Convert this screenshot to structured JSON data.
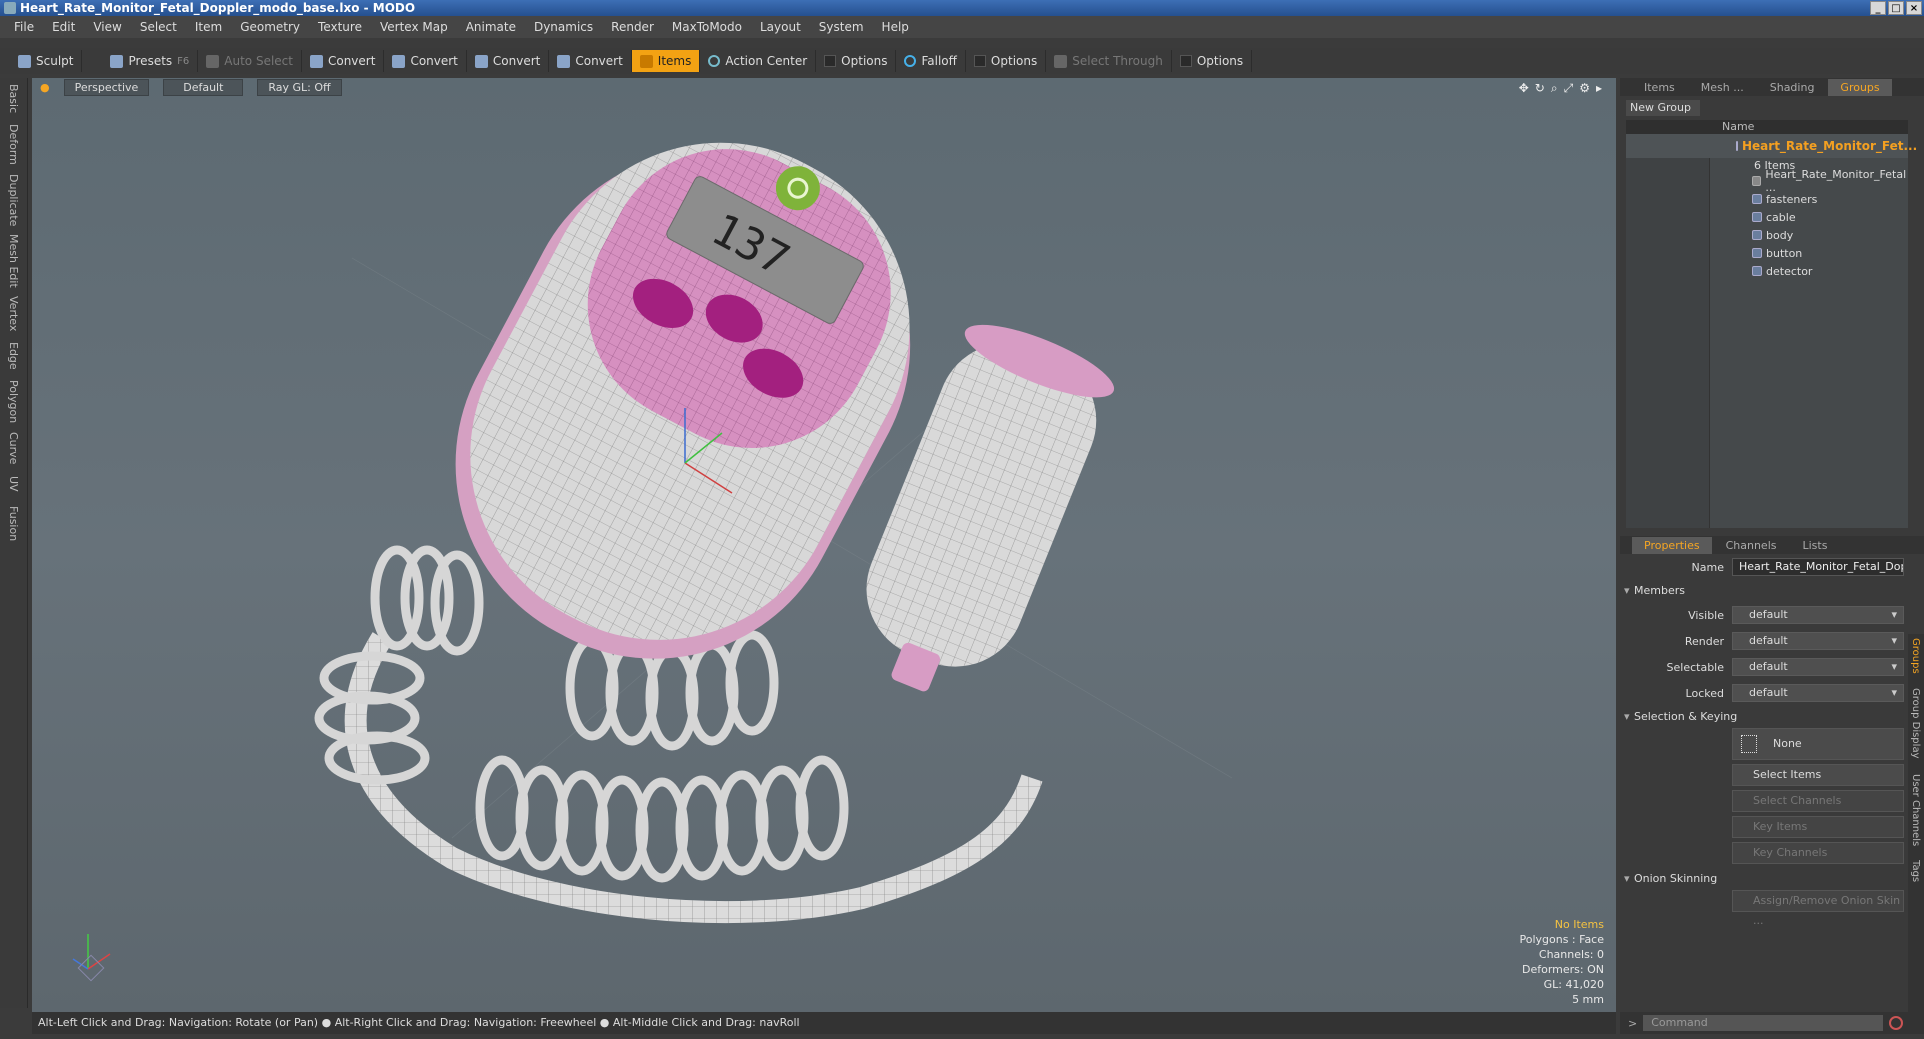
{
  "window": {
    "title": "Heart_Rate_Monitor_Fetal_Doppler_modo_base.lxo - MODO"
  },
  "menu": [
    "File",
    "Edit",
    "View",
    "Select",
    "Item",
    "Geometry",
    "Texture",
    "Vertex Map",
    "Animate",
    "Dynamics",
    "Render",
    "MaxToModo",
    "Layout",
    "System",
    "Help"
  ],
  "toolbar": {
    "sculpt": "Sculpt",
    "presets": "Presets",
    "presets_hotkey": "F6",
    "auto_select": "Auto Select",
    "convert1": "Convert",
    "convert2": "Convert",
    "convert3": "Convert",
    "convert4": "Convert",
    "items": "Items",
    "action_center": "Action Center",
    "options1": "Options",
    "falloff": "Falloff",
    "options2": "Options",
    "select_through": "Select Through",
    "options3": "Options"
  },
  "left_tabs": [
    "Basic",
    "Deform",
    "Duplicate",
    "Mesh Edit",
    "Vertex",
    "Edge",
    "Polygon",
    "Curve",
    "UV",
    "Fusion"
  ],
  "viewport": {
    "view": "Perspective",
    "shading": "Default",
    "raygl": "Ray GL: Off",
    "display_value": "137",
    "stats": {
      "items": "No Items",
      "polygons": "Polygons : Face",
      "channels": "Channels: 0",
      "deformers": "Deformers: ON",
      "gl": "GL: 41,020",
      "unit": "5 mm"
    }
  },
  "status": {
    "hint": "Alt-Left Click and Drag: Navigation: Rotate (or Pan) ● Alt-Right Click and Drag: Navigation: Freewheel ● Alt-Middle Click and Drag: navRoll"
  },
  "right_panel": {
    "tabs": [
      "Items",
      "Mesh ...",
      "Shading",
      "Groups"
    ],
    "active_tab": "Groups",
    "new_group": "New Group",
    "col_name": "Name",
    "root_name": "Heart_Rate_Monitor_Fet...",
    "root_count": "6 Items",
    "children": [
      "Heart_Rate_Monitor_Fetal ...",
      "fasteners",
      "cable",
      "body",
      "button",
      "detector"
    ],
    "prop_tabs": [
      "Properties",
      "Channels",
      "Lists"
    ],
    "name_label": "Name",
    "name_value": "Heart_Rate_Monitor_Fetal_Doppl",
    "members": "Members",
    "visible_label": "Visible",
    "render_label": "Render",
    "selectable_label": "Selectable",
    "locked_label": "Locked",
    "default_value": "default",
    "selection_keying": "Selection & Keying",
    "none": "None",
    "select_items": "Select Items",
    "select_channels": "Select Channels",
    "key_items": "Key Items",
    "key_channels": "Key Channels",
    "onion": "Onion Skinning",
    "assign_onion": "Assign/Remove Onion Skin ...",
    "side_tabs": [
      "Groups",
      "Group Display",
      "User Channels",
      "Tags"
    ],
    "command_placeholder": "Command"
  }
}
